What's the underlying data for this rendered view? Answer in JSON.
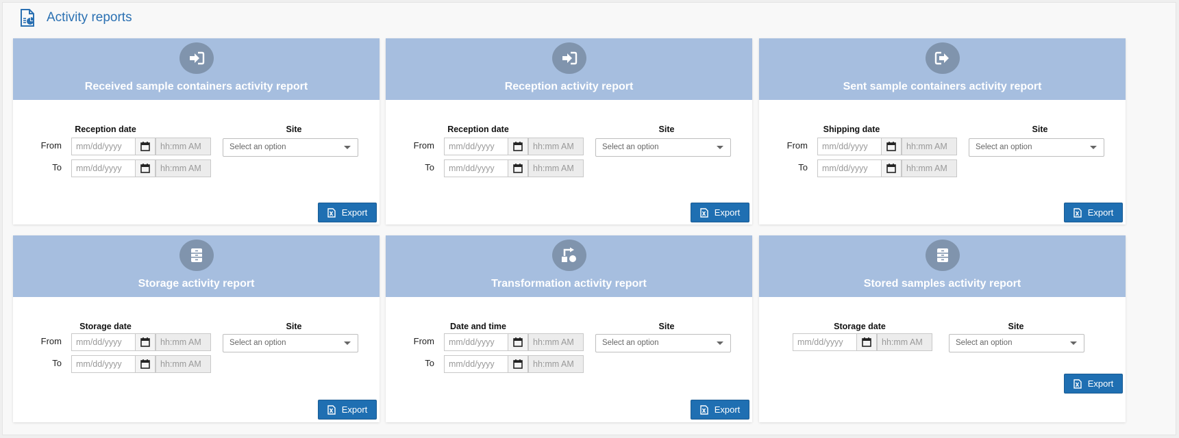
{
  "header": {
    "title": "Activity reports",
    "icon": "report-document-icon"
  },
  "common": {
    "from_label": "From",
    "to_label": "To",
    "site_label": "Site",
    "date_placeholder": "mm/dd/yyyy",
    "time_placeholder": "hh:mm AM",
    "select_placeholder": "Select an option",
    "export_label": "Export"
  },
  "cards": [
    {
      "title": "Received sample containers activity report",
      "date_label": "Reception date",
      "icon": "sign-in-icon"
    },
    {
      "title": "Reception activity report",
      "date_label": "Reception date",
      "icon": "sign-in-icon"
    },
    {
      "title": "Sent sample containers activity report",
      "date_label": "Shipping date",
      "icon": "sign-out-icon"
    },
    {
      "title": "Storage activity report",
      "date_label": "Storage date",
      "icon": "storage-cabinet-icon"
    },
    {
      "title": "Transformation activity report",
      "date_label": "Date and time",
      "icon": "transformation-icon"
    },
    {
      "title": "Stored samples activity report",
      "date_label": "Storage date",
      "icon": "storage-cabinet-icon"
    }
  ],
  "colors": {
    "header_band": "#a6bedf",
    "badge": "#8094ad",
    "accent": "#1f6fb2",
    "title_text": "#2a70b2"
  }
}
